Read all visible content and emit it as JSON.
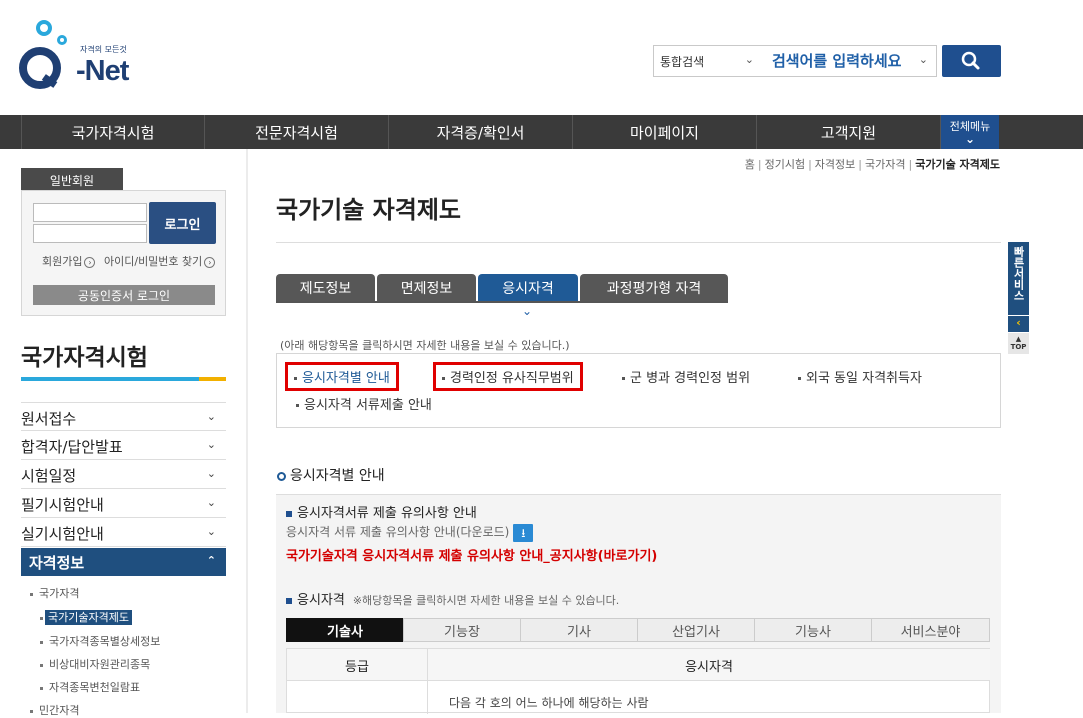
{
  "brand": {
    "tagline": "자격의 모든것",
    "name": "-Net"
  },
  "search": {
    "type_label": "통합검색",
    "placeholder": "검색어를 입력하세요"
  },
  "gnb": {
    "items": [
      "국가자격시험",
      "전문자격시험",
      "자격증/확인서",
      "마이페이지",
      "고객지원"
    ],
    "all_menu": "전체메뉴"
  },
  "login": {
    "member_tab": "일반회원",
    "button": "로그인",
    "signup": "회원가입",
    "find": "아이디/비밀번호 찾기",
    "cert_login": "공동인증서 로그인"
  },
  "sidebar": {
    "title": "국가자격시험",
    "menu": [
      "원서접수",
      "합격자/답안발표",
      "시험일정",
      "필기시험안내",
      "실기시험안내"
    ],
    "active": "자격정보",
    "sub": [
      "국가자격",
      "국가기술자격제도",
      "국가자격종목별상세정보",
      "비상대비자원관리종목",
      "자격종목변천일람표"
    ],
    "next": "민간자격"
  },
  "breadcrumb": [
    "홈",
    "정기시험",
    "자격정보",
    "국가자격",
    "국가기술 자격제도"
  ],
  "page_title": "국가기술 자격제도",
  "tabs": [
    "제도정보",
    "면제정보",
    "응시자격",
    "과정평가형 자격"
  ],
  "hint": "(아래 해당항목을 클릭하시면 자세한 내용을 보실 수 있습니다.)",
  "quick_links": [
    "응시자격별 안내",
    "경력인정 유사직무범위",
    "군 병과 경력인정 범위",
    "외국 동일 자격취득자",
    "응시자격 서류제출 안내"
  ],
  "section": {
    "title": "응시자격별 안내",
    "notice_title": "응시자격서류 제출 유의사항 안내",
    "notice_download": "응시자격 서류 제출 유의사항 안내(다운로드)",
    "notice_link": "국가기술자격 응시자격서류 제출 유의사항 안내_공지사항(바로가기)",
    "qual_title": "응시자격",
    "qual_note": "※해당항목을 클릭하시면 자세한 내용을 보실 수 있습니다.",
    "subtabs": [
      "기술사",
      "기능장",
      "기사",
      "산업기사",
      "기능사",
      "서비스분야"
    ],
    "table_headers": [
      "등급",
      "응시자격"
    ],
    "table_row_text": "다음 각 호의 어느 하나에 해당하는 사람"
  },
  "quick_service": {
    "label": "빠른서비스",
    "top": "TOP"
  }
}
